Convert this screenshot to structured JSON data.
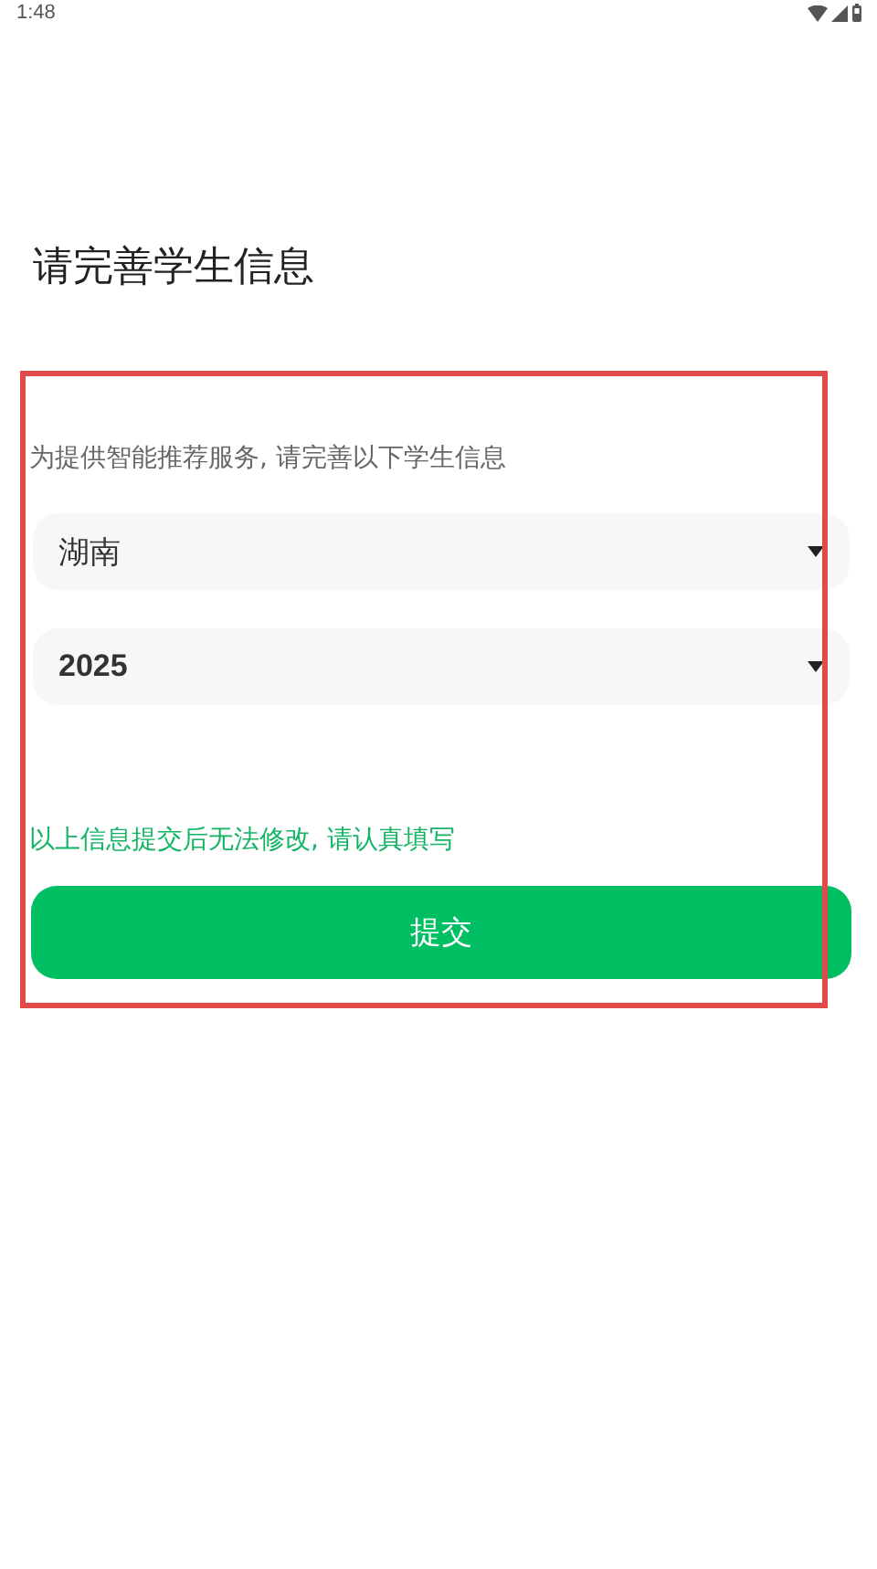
{
  "status_bar": {
    "time": "1:48"
  },
  "title": "请完善学生信息",
  "subtitle": "为提供智能推荐服务, 请完善以下学生信息",
  "dropdowns": [
    {
      "value": "湖南",
      "bold": false
    },
    {
      "value": "2025",
      "bold": true
    }
  ],
  "notice": "以上信息提交后无法修改, 请认真填写",
  "submit_button": "提交",
  "annotation": {
    "kind": "highlight-box"
  }
}
